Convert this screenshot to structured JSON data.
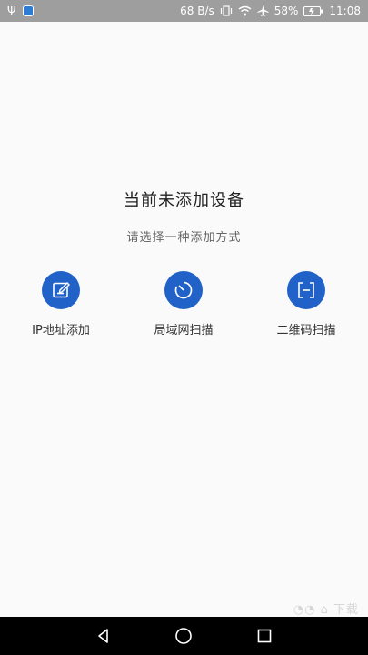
{
  "status_bar": {
    "net_speed": "68 B/s",
    "battery": "58%",
    "time": "11:08",
    "icons": [
      "usb-icon",
      "shield-icon",
      "vibrate-icon",
      "wifi-icon",
      "airplane-icon",
      "battery-icon"
    ]
  },
  "main": {
    "title": "当前未添加设备",
    "subtitle": "请选择一种添加方式",
    "options": [
      {
        "label": "IP地址添加",
        "icon": "edit-note-icon"
      },
      {
        "label": "局域网扫描",
        "icon": "radar-scan-icon"
      },
      {
        "label": "二维码扫描",
        "icon": "qr-scan-icon"
      }
    ],
    "accent_color": "#2162c9"
  },
  "nav_bar": {
    "buttons": [
      "back-icon",
      "home-icon",
      "recents-icon"
    ]
  }
}
